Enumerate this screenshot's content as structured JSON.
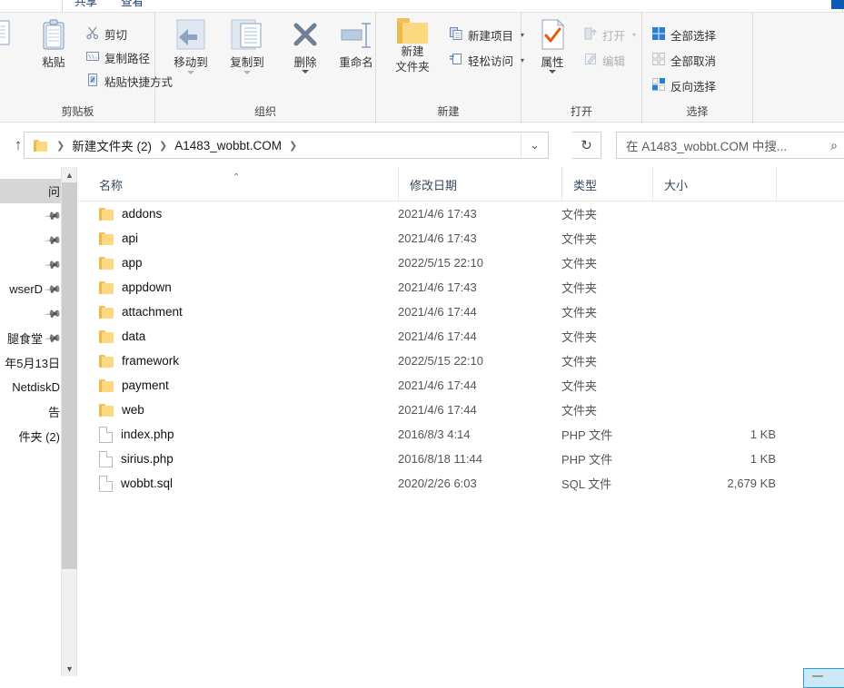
{
  "window": {
    "tabs": [
      "共享",
      "查看"
    ]
  },
  "ribbon": {
    "groups": [
      {
        "name": "clipboard",
        "label": "剪贴板",
        "big": [
          {
            "label": "粘贴",
            "icon": "clipboard-icon"
          }
        ],
        "small": [
          {
            "label": "剪切",
            "icon": "scissors-icon",
            "dim": false
          },
          {
            "label": "复制路径",
            "icon": "copy-path-icon",
            "dim": false
          },
          {
            "label": "粘贴快捷方式",
            "icon": "paste-shortcut-icon",
            "dim": false
          }
        ]
      },
      {
        "name": "organize",
        "label": "组织",
        "big": [
          {
            "label": "移动到",
            "icon": "move-to-icon",
            "caret": true
          },
          {
            "label": "复制到",
            "icon": "copy-to-icon",
            "caret": true
          },
          {
            "label": "删除",
            "icon": "delete-x-icon",
            "caret": true
          },
          {
            "label": "重命名",
            "icon": "rename-icon",
            "caret": false
          }
        ]
      },
      {
        "name": "new",
        "label": "新建",
        "big": [
          {
            "label": "新建\n文件夹",
            "label_line1": "新建",
            "label_line2": "文件夹",
            "icon": "new-folder-icon"
          }
        ],
        "small": [
          {
            "label": "新建项目",
            "icon": "new-item-icon",
            "caret": true
          },
          {
            "label": "轻松访问",
            "icon": "easy-access-icon",
            "caret": true
          }
        ]
      },
      {
        "name": "open",
        "label": "打开",
        "big": [
          {
            "label": "属性",
            "icon": "properties-icon",
            "caret": true
          }
        ],
        "small": [
          {
            "label": "打开",
            "icon": "open-icon",
            "caret": true,
            "dim": true
          },
          {
            "label": "编辑",
            "icon": "edit-icon",
            "caret": false,
            "dim": true
          }
        ]
      },
      {
        "name": "select",
        "label": "选择",
        "small": [
          {
            "label": "全部选择",
            "icon": "select-all-icon"
          },
          {
            "label": "全部取消",
            "icon": "select-none-icon"
          },
          {
            "label": "反向选择",
            "icon": "invert-selection-icon"
          }
        ]
      }
    ]
  },
  "address": {
    "up_tooltip": "↑",
    "crumbs": [
      "新建文件夹 (2)",
      "A1483_wobbt.COM"
    ],
    "dropdown_glyph": "⌄",
    "refresh_glyph": "↻",
    "search_placeholder": "在 A1483_wobbt.COM 中搜...",
    "search_glyph": "⌕"
  },
  "navpane": {
    "items": [
      {
        "label": "问",
        "selected": true,
        "pin": false
      },
      {
        "label": "",
        "selected": false,
        "pin": true
      },
      {
        "label": "",
        "selected": false,
        "pin": true
      },
      {
        "label": "",
        "selected": false,
        "pin": true
      },
      {
        "label": "wserD",
        "selected": false,
        "pin": true
      },
      {
        "label": "",
        "selected": false,
        "pin": true
      },
      {
        "label": "腿食堂",
        "selected": false,
        "pin": true
      },
      {
        "label": "年5月13日",
        "selected": false,
        "pin": false
      },
      {
        "label": "NetdiskD",
        "selected": false,
        "pin": false
      },
      {
        "label": "告",
        "selected": false,
        "pin": false
      },
      {
        "label": "件夹 (2)",
        "selected": false,
        "pin": false
      }
    ]
  },
  "filelist": {
    "columns": [
      {
        "key": "name",
        "label": "名称",
        "sorted": true,
        "sort_glyph": "⌃"
      },
      {
        "key": "date",
        "label": "修改日期"
      },
      {
        "key": "type",
        "label": "类型"
      },
      {
        "key": "size",
        "label": "大小"
      }
    ],
    "rows": [
      {
        "name": "addons",
        "date": "2021/4/6 17:43",
        "type": "文件夹",
        "size": "",
        "kind": "folder"
      },
      {
        "name": "api",
        "date": "2021/4/6 17:43",
        "type": "文件夹",
        "size": "",
        "kind": "folder"
      },
      {
        "name": "app",
        "date": "2022/5/15 22:10",
        "type": "文件夹",
        "size": "",
        "kind": "folder"
      },
      {
        "name": "appdown",
        "date": "2021/4/6 17:43",
        "type": "文件夹",
        "size": "",
        "kind": "folder"
      },
      {
        "name": "attachment",
        "date": "2021/4/6 17:44",
        "type": "文件夹",
        "size": "",
        "kind": "folder"
      },
      {
        "name": "data",
        "date": "2021/4/6 17:44",
        "type": "文件夹",
        "size": "",
        "kind": "folder"
      },
      {
        "name": "framework",
        "date": "2022/5/15 22:10",
        "type": "文件夹",
        "size": "",
        "kind": "folder"
      },
      {
        "name": "payment",
        "date": "2021/4/6 17:44",
        "type": "文件夹",
        "size": "",
        "kind": "folder"
      },
      {
        "name": "web",
        "date": "2021/4/6 17:44",
        "type": "文件夹",
        "size": "",
        "kind": "folder"
      },
      {
        "name": "index.php",
        "date": "2016/8/3 4:14",
        "type": "PHP 文件",
        "size": "1 KB",
        "kind": "file"
      },
      {
        "name": "sirius.php",
        "date": "2016/8/18 11:44",
        "type": "PHP 文件",
        "size": "1 KB",
        "kind": "file"
      },
      {
        "name": "wobbt.sql",
        "date": "2020/2/26 6:03",
        "type": "SQL 文件",
        "size": "2,679 KB",
        "kind": "file"
      }
    ]
  },
  "colors": {
    "accent": "#0b5cb5",
    "folder": "#fcd980",
    "folder_dark": "#eeb94a",
    "selection": "#cce8f6",
    "selection_border": "#26a0da",
    "ribbon_bg": "#f6f6f6"
  }
}
